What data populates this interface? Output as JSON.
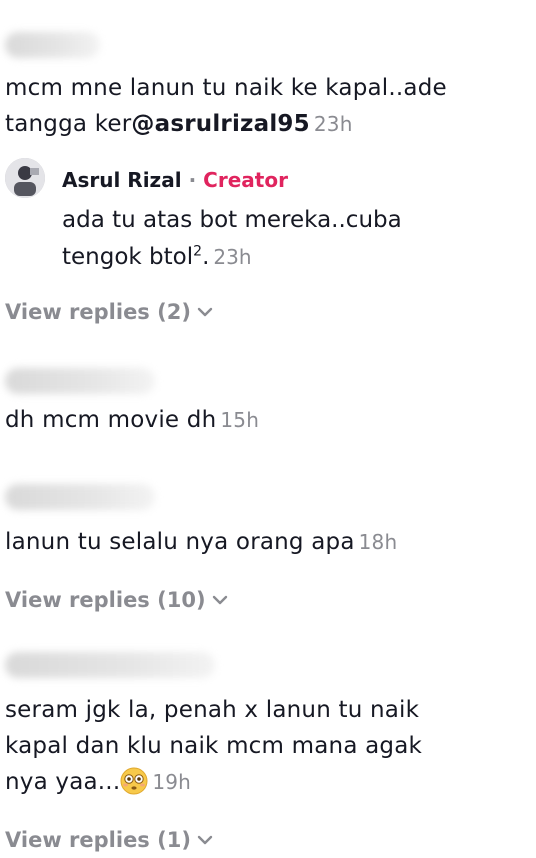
{
  "comments": [
    {
      "text_main": "mcm mne lanun tu naik ke kapal..ade tangga ker",
      "mention": "@asrulrizal95",
      "time": "23h"
    },
    {
      "text": "dh mcm movie dh",
      "time": "15h"
    },
    {
      "text": "lanun tu selalu nya orang apa",
      "time": "18h",
      "view_replies": "View replies (10)"
    },
    {
      "text_line1": "seram jgk la, penah x lanun tu naik",
      "text_line2": "kapal dan klu naik mcm mana agak",
      "text_line3": "nya yaa...",
      "emoji": "flushed-face",
      "time": "19h",
      "view_replies": "View replies (1)"
    }
  ],
  "reply": {
    "author": "Asrul Rizal",
    "separator": "·",
    "badge": "Creator",
    "text_line1": "ada tu atas bot mereka..cuba",
    "text_line2": "tengok btol",
    "superscript": "2",
    "text_end": ".",
    "time": "23h"
  },
  "first_view_replies": "View replies (2)",
  "colors": {
    "text": "#161823",
    "muted": "#8a8b91",
    "creator": "#e0245e"
  }
}
